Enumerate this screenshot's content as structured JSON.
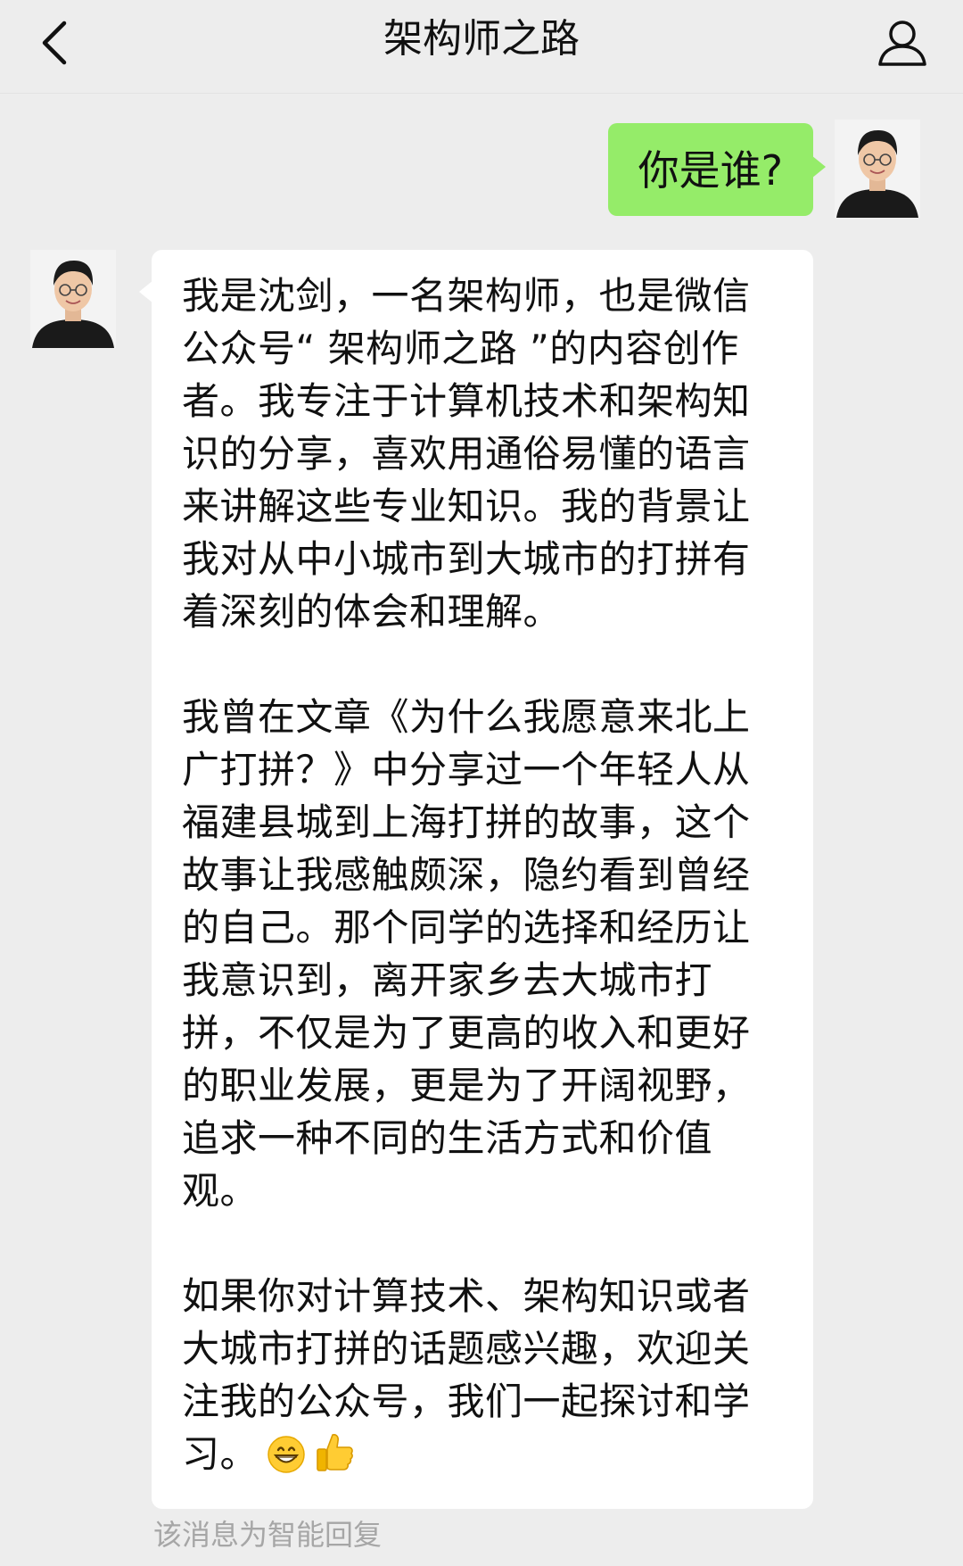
{
  "header": {
    "title": "架构师之路"
  },
  "icons": {
    "back": "chevron-left-icon",
    "profile": "person-icon",
    "avatar_me": "avatar",
    "avatar_bot": "avatar",
    "emoji_grin": "grinning-face-icon",
    "emoji_thumbs": "thumbs-up-icon"
  },
  "messages": {
    "sent": {
      "text": "你是谁?"
    },
    "received": {
      "paragraphs": [
        "我是沈剑，一名架构师，也是微信公众号“ 架构师之路 ”的内容创作者。我专注于计算机技术和架构知识的分享，喜欢用通俗易懂的语言来讲解这些专业知识。我的背景让我对从中小城市到大城市的打拼有着深刻的体会和理解。",
        "我曾在文章《为什么我愿意来北上广打拼？》中分享过一个年轻人从福建县城到上海打拼的故事，这个故事让我感触颇深，隐约看到曾经的自己。那个同学的选择和经历让我意识到，离开家乡去大城市打拼，不仅是为了更高的收入和更好的职业发展，更是为了开阔视野，追求一种不同的生活方式和价值观。",
        "如果你对计算技术、架构知识或者大城市打拼的话题感兴趣，欢迎关注我的公众号，我们一起探讨和学习。"
      ]
    },
    "footnote": "该消息为智能回复"
  },
  "colors": {
    "background": "#ededed",
    "sent_bubble": "#95ec69",
    "received_bubble": "#ffffff",
    "footnote": "#a6a6a6"
  }
}
